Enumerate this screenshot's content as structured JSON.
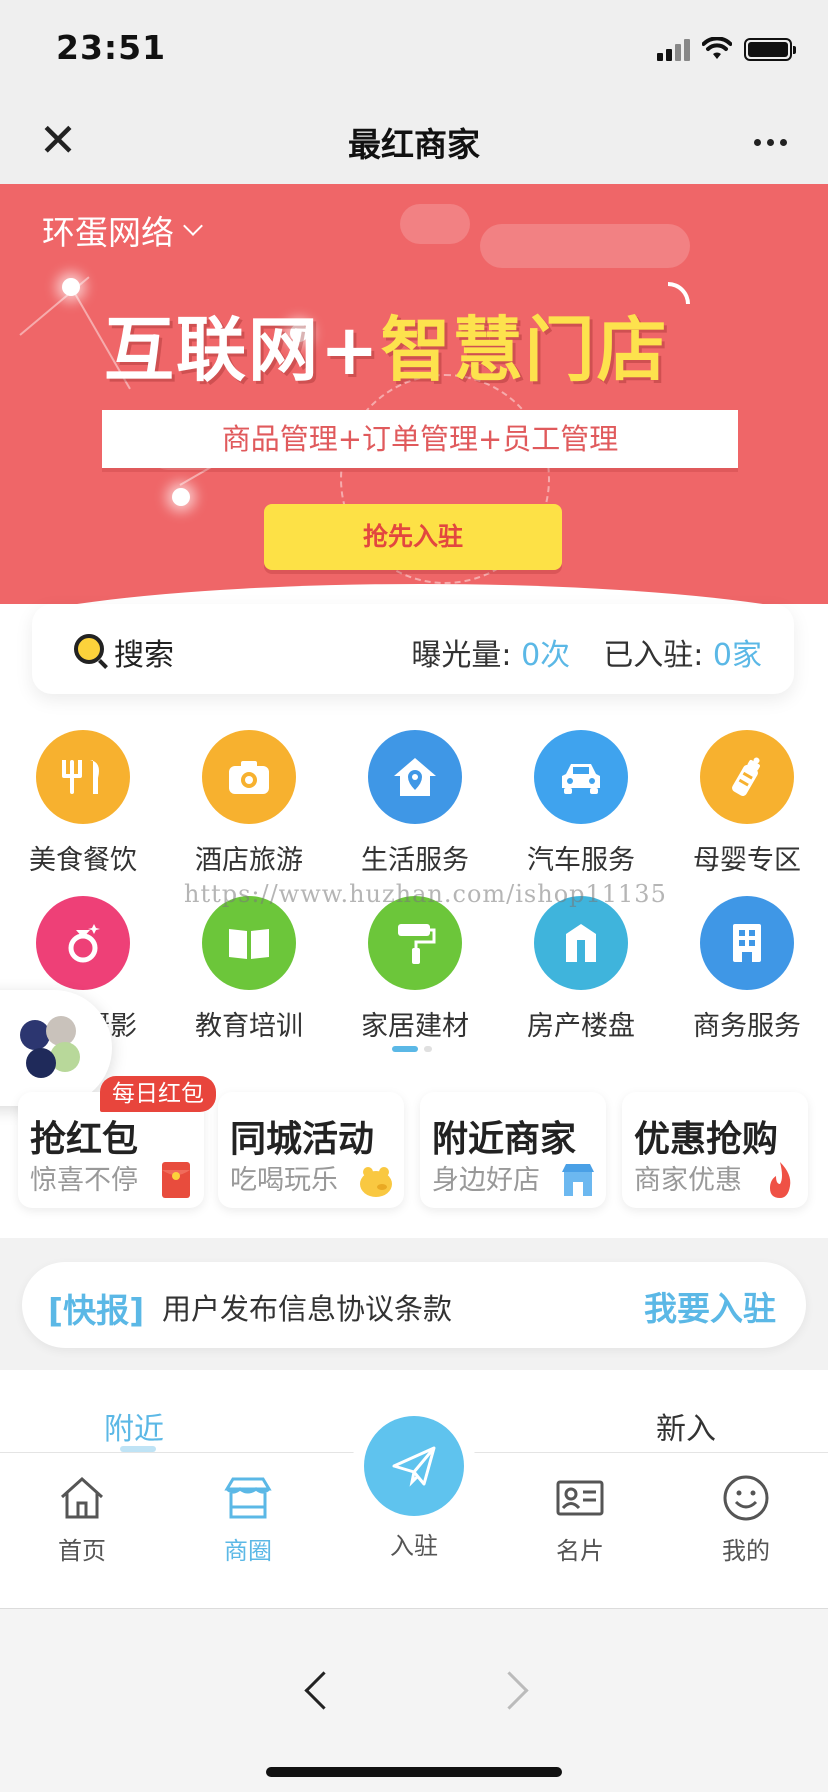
{
  "status": {
    "time": "23:51"
  },
  "nav": {
    "title": "最红商家"
  },
  "banner": {
    "location": "环蛋网络",
    "headline_a": "互联网+",
    "headline_b": "智慧门店",
    "subtitle": "商品管理+订单管理+员工管理",
    "cta": "抢先入驻"
  },
  "search": {
    "label": "搜索",
    "exposure_label": "曝光量:",
    "exposure_value": "0次",
    "joined_label": "已入驻:",
    "joined_value": "0家"
  },
  "categories": [
    {
      "label": "美食餐饮",
      "color": "#f7b12f",
      "icon": "fork-knife-icon"
    },
    {
      "label": "酒店旅游",
      "color": "#f7b12f",
      "icon": "camera-icon"
    },
    {
      "label": "生活服务",
      "color": "#3f97e6",
      "icon": "home-pin-icon"
    },
    {
      "label": "汽车服务",
      "color": "#3fa3ee",
      "icon": "car-icon"
    },
    {
      "label": "母婴专区",
      "color": "#f7b12f",
      "icon": "baby-bottle-icon"
    },
    {
      "label": "婚纱摄影",
      "color": "#ee4077",
      "icon": "ring-icon"
    },
    {
      "label": "教育培训",
      "color": "#6cc63a",
      "icon": "book-icon"
    },
    {
      "label": "家居建材",
      "color": "#6cc63a",
      "icon": "paint-roller-icon"
    },
    {
      "label": "房产楼盘",
      "color": "#3fb4dc",
      "icon": "building-door-icon"
    },
    {
      "label": "商务服务",
      "color": "#3f97e6",
      "icon": "office-building-icon"
    }
  ],
  "watermark": "https://www.huzhan.com/ishop11135",
  "promos": [
    {
      "title": "抢红包",
      "sub": "惊喜不停",
      "icon": "red-envelope-icon"
    },
    {
      "title": "同城活动",
      "sub": "吃喝玩乐",
      "icon": "pig-icon"
    },
    {
      "title": "附近商家",
      "sub": "身边好店",
      "icon": "shop-icon"
    },
    {
      "title": "优惠抢购",
      "sub": "商家优惠",
      "icon": "flame-icon"
    }
  ],
  "promo_badge": "每日红包",
  "news": {
    "tag": "[快报]",
    "text": "用户发布信息协议条款",
    "cta": "我要入驻"
  },
  "tabs": [
    "附近",
    "新入"
  ],
  "tabbar": {
    "home": "首页",
    "circle": "商圈",
    "join": "入驻",
    "card": "名片",
    "mine": "我的"
  },
  "colors": {
    "accent": "#5bb8e6",
    "banner": "#ef6668",
    "cta_yellow": "#fde146"
  }
}
